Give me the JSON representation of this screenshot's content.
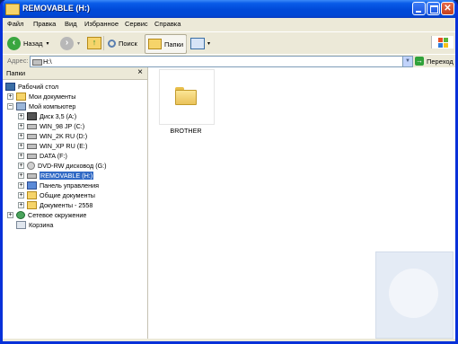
{
  "window": {
    "title": "REMOVABLE (H:)"
  },
  "menu": [
    "Файл",
    "Правка",
    "Вид",
    "Избранное",
    "Сервис",
    "Справка"
  ],
  "toolbar": {
    "back": "Назад",
    "search": "Поиск",
    "folders": "Папки"
  },
  "address": {
    "label": "Адрес:",
    "value": "H:\\",
    "go": "Переход"
  },
  "folders_panel": {
    "title": "Папки",
    "close": "×",
    "items": [
      {
        "label": "Рабочий стол"
      },
      {
        "label": "Мои документы"
      },
      {
        "label": "Мой компьютер"
      },
      {
        "label": "Диск 3,5 (A:)"
      },
      {
        "label": "WIN_98 JP (C:)"
      },
      {
        "label": "WIN_2K RU (D:)"
      },
      {
        "label": "WIN_XP RU (E:)"
      },
      {
        "label": "DATA (F:)"
      },
      {
        "label": "DVD-RW дисковод (G:)"
      },
      {
        "label": "REMOVABLE (H:)"
      },
      {
        "label": "Панель управления"
      },
      {
        "label": "Общие документы"
      },
      {
        "label": "Документы - 2558"
      },
      {
        "label": "Сетевое окружение"
      },
      {
        "label": "Корзина"
      }
    ]
  },
  "content": {
    "items": [
      {
        "label": "BROTHER"
      }
    ]
  },
  "colors": {
    "title_bar": "#0049d8",
    "selection": "#316ac5",
    "chrome": "#ece9d8"
  }
}
